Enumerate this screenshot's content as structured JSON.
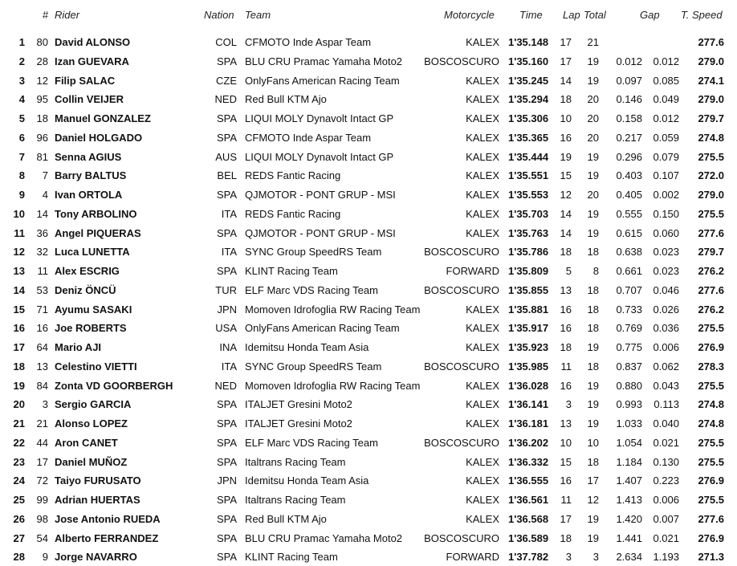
{
  "headers": {
    "pos": "#",
    "rider": "Rider",
    "nation": "Nation",
    "team": "Team",
    "motorcycle": "Motorcycle",
    "time": "Time",
    "lap": "Lap",
    "total": "Total",
    "gap": "Gap",
    "speed": "T. Speed"
  },
  "rows": [
    {
      "pos": "1",
      "num": "80",
      "rider": "David ALONSO",
      "nation": "COL",
      "team": "CFMOTO Inde Aspar Team",
      "moto": "KALEX",
      "time": "1'35.148",
      "lap": "17",
      "total": "21",
      "gap1": "",
      "gap2": "",
      "speed": "277.6"
    },
    {
      "pos": "2",
      "num": "28",
      "rider": "Izan GUEVARA",
      "nation": "SPA",
      "team": "BLU CRU Pramac Yamaha Moto2",
      "moto": "BOSCOSCURO",
      "time": "1'35.160",
      "lap": "17",
      "total": "19",
      "gap1": "0.012",
      "gap2": "0.012",
      "speed": "279.0"
    },
    {
      "pos": "3",
      "num": "12",
      "rider": "Filip SALAC",
      "nation": "CZE",
      "team": "OnlyFans American Racing Team",
      "moto": "KALEX",
      "time": "1'35.245",
      "lap": "14",
      "total": "19",
      "gap1": "0.097",
      "gap2": "0.085",
      "speed": "274.1"
    },
    {
      "pos": "4",
      "num": "95",
      "rider": "Collin VEIJER",
      "nation": "NED",
      "team": "Red Bull KTM Ajo",
      "moto": "KALEX",
      "time": "1'35.294",
      "lap": "18",
      "total": "20",
      "gap1": "0.146",
      "gap2": "0.049",
      "speed": "279.0"
    },
    {
      "pos": "5",
      "num": "18",
      "rider": "Manuel GONZALEZ",
      "nation": "SPA",
      "team": "LIQUI MOLY Dynavolt Intact GP",
      "moto": "KALEX",
      "time": "1'35.306",
      "lap": "10",
      "total": "20",
      "gap1": "0.158",
      "gap2": "0.012",
      "speed": "279.7"
    },
    {
      "pos": "6",
      "num": "96",
      "rider": "Daniel HOLGADO",
      "nation": "SPA",
      "team": "CFMOTO Inde Aspar Team",
      "moto": "KALEX",
      "time": "1'35.365",
      "lap": "16",
      "total": "20",
      "gap1": "0.217",
      "gap2": "0.059",
      "speed": "274.8"
    },
    {
      "pos": "7",
      "num": "81",
      "rider": "Senna AGIUS",
      "nation": "AUS",
      "team": "LIQUI MOLY Dynavolt Intact GP",
      "moto": "KALEX",
      "time": "1'35.444",
      "lap": "19",
      "total": "19",
      "gap1": "0.296",
      "gap2": "0.079",
      "speed": "275.5"
    },
    {
      "pos": "8",
      "num": "7",
      "rider": "Barry BALTUS",
      "nation": "BEL",
      "team": "REDS Fantic Racing",
      "moto": "KALEX",
      "time": "1'35.551",
      "lap": "15",
      "total": "19",
      "gap1": "0.403",
      "gap2": "0.107",
      "speed": "272.0"
    },
    {
      "pos": "9",
      "num": "4",
      "rider": "Ivan ORTOLA",
      "nation": "SPA",
      "team": "QJMOTOR - PONT GRUP - MSI",
      "moto": "KALEX",
      "time": "1'35.553",
      "lap": "12",
      "total": "20",
      "gap1": "0.405",
      "gap2": "0.002",
      "speed": "279.0"
    },
    {
      "pos": "10",
      "num": "14",
      "rider": "Tony ARBOLINO",
      "nation": "ITA",
      "team": "REDS Fantic Racing",
      "moto": "KALEX",
      "time": "1'35.703",
      "lap": "14",
      "total": "19",
      "gap1": "0.555",
      "gap2": "0.150",
      "speed": "275.5"
    },
    {
      "pos": "11",
      "num": "36",
      "rider": "Angel PIQUERAS",
      "nation": "SPA",
      "team": "QJMOTOR - PONT GRUP - MSI",
      "moto": "KALEX",
      "time": "1'35.763",
      "lap": "14",
      "total": "19",
      "gap1": "0.615",
      "gap2": "0.060",
      "speed": "277.6"
    },
    {
      "pos": "12",
      "num": "32",
      "rider": "Luca LUNETTA",
      "nation": "ITA",
      "team": "SYNC Group SpeedRS Team",
      "moto": "BOSCOSCURO",
      "time": "1'35.786",
      "lap": "18",
      "total": "18",
      "gap1": "0.638",
      "gap2": "0.023",
      "speed": "279.7"
    },
    {
      "pos": "13",
      "num": "11",
      "rider": "Alex ESCRIG",
      "nation": "SPA",
      "team": "KLINT Racing Team",
      "moto": "FORWARD",
      "time": "1'35.809",
      "lap": "5",
      "total": "8",
      "gap1": "0.661",
      "gap2": "0.023",
      "speed": "276.2"
    },
    {
      "pos": "14",
      "num": "53",
      "rider": "Deniz ÖNCÜ",
      "nation": "TUR",
      "team": "ELF Marc VDS Racing Team",
      "moto": "BOSCOSCURO",
      "time": "1'35.855",
      "lap": "13",
      "total": "18",
      "gap1": "0.707",
      "gap2": "0.046",
      "speed": "277.6"
    },
    {
      "pos": "15",
      "num": "71",
      "rider": "Ayumu SASAKI",
      "nation": "JPN",
      "team": "Momoven Idrofoglia RW Racing Team",
      "moto": "KALEX",
      "time": "1'35.881",
      "lap": "16",
      "total": "18",
      "gap1": "0.733",
      "gap2": "0.026",
      "speed": "276.2"
    },
    {
      "pos": "16",
      "num": "16",
      "rider": "Joe ROBERTS",
      "nation": "USA",
      "team": "OnlyFans American Racing Team",
      "moto": "KALEX",
      "time": "1'35.917",
      "lap": "16",
      "total": "18",
      "gap1": "0.769",
      "gap2": "0.036",
      "speed": "275.5"
    },
    {
      "pos": "17",
      "num": "64",
      "rider": "Mario AJI",
      "nation": "INA",
      "team": "Idemitsu Honda Team Asia",
      "moto": "KALEX",
      "time": "1'35.923",
      "lap": "18",
      "total": "19",
      "gap1": "0.775",
      "gap2": "0.006",
      "speed": "276.9"
    },
    {
      "pos": "18",
      "num": "13",
      "rider": "Celestino VIETTI",
      "nation": "ITA",
      "team": "SYNC Group SpeedRS Team",
      "moto": "BOSCOSCURO",
      "time": "1'35.985",
      "lap": "11",
      "total": "18",
      "gap1": "0.837",
      "gap2": "0.062",
      "speed": "278.3"
    },
    {
      "pos": "19",
      "num": "84",
      "rider": "Zonta VD GOORBERGH",
      "nation": "NED",
      "team": "Momoven Idrofoglia RW Racing Team",
      "moto": "KALEX",
      "time": "1'36.028",
      "lap": "16",
      "total": "19",
      "gap1": "0.880",
      "gap2": "0.043",
      "speed": "275.5"
    },
    {
      "pos": "20",
      "num": "3",
      "rider": "Sergio GARCIA",
      "nation": "SPA",
      "team": "ITALJET Gresini Moto2",
      "moto": "KALEX",
      "time": "1'36.141",
      "lap": "3",
      "total": "19",
      "gap1": "0.993",
      "gap2": "0.113",
      "speed": "274.8"
    },
    {
      "pos": "21",
      "num": "21",
      "rider": "Alonso LOPEZ",
      "nation": "SPA",
      "team": "ITALJET Gresini Moto2",
      "moto": "KALEX",
      "time": "1'36.181",
      "lap": "13",
      "total": "19",
      "gap1": "1.033",
      "gap2": "0.040",
      "speed": "274.8"
    },
    {
      "pos": "22",
      "num": "44",
      "rider": "Aron CANET",
      "nation": "SPA",
      "team": "ELF Marc VDS Racing Team",
      "moto": "BOSCOSCURO",
      "time": "1'36.202",
      "lap": "10",
      "total": "10",
      "gap1": "1.054",
      "gap2": "0.021",
      "speed": "275.5"
    },
    {
      "pos": "23",
      "num": "17",
      "rider": "Daniel MUÑOZ",
      "nation": "SPA",
      "team": "Italtrans Racing Team",
      "moto": "KALEX",
      "time": "1'36.332",
      "lap": "15",
      "total": "18",
      "gap1": "1.184",
      "gap2": "0.130",
      "speed": "275.5"
    },
    {
      "pos": "24",
      "num": "72",
      "rider": "Taiyo FURUSATO",
      "nation": "JPN",
      "team": "Idemitsu Honda Team Asia",
      "moto": "KALEX",
      "time": "1'36.555",
      "lap": "16",
      "total": "17",
      "gap1": "1.407",
      "gap2": "0.223",
      "speed": "276.9"
    },
    {
      "pos": "25",
      "num": "99",
      "rider": "Adrian HUERTAS",
      "nation": "SPA",
      "team": "Italtrans Racing Team",
      "moto": "KALEX",
      "time": "1'36.561",
      "lap": "11",
      "total": "12",
      "gap1": "1.413",
      "gap2": "0.006",
      "speed": "275.5"
    },
    {
      "pos": "26",
      "num": "98",
      "rider": "Jose Antonio RUEDA",
      "nation": "SPA",
      "team": "Red Bull KTM Ajo",
      "moto": "KALEX",
      "time": "1'36.568",
      "lap": "17",
      "total": "19",
      "gap1": "1.420",
      "gap2": "0.007",
      "speed": "277.6"
    },
    {
      "pos": "27",
      "num": "54",
      "rider": "Alberto FERRANDEZ",
      "nation": "SPA",
      "team": "BLU CRU Pramac Yamaha Moto2",
      "moto": "BOSCOSCURO",
      "time": "1'36.589",
      "lap": "18",
      "total": "19",
      "gap1": "1.441",
      "gap2": "0.021",
      "speed": "276.9"
    },
    {
      "pos": "28",
      "num": "9",
      "rider": "Jorge NAVARRO",
      "nation": "SPA",
      "team": "KLINT Racing Team",
      "moto": "FORWARD",
      "time": "1'37.782",
      "lap": "3",
      "total": "3",
      "gap1": "2.634",
      "gap2": "1.193",
      "speed": "271.3"
    }
  ]
}
